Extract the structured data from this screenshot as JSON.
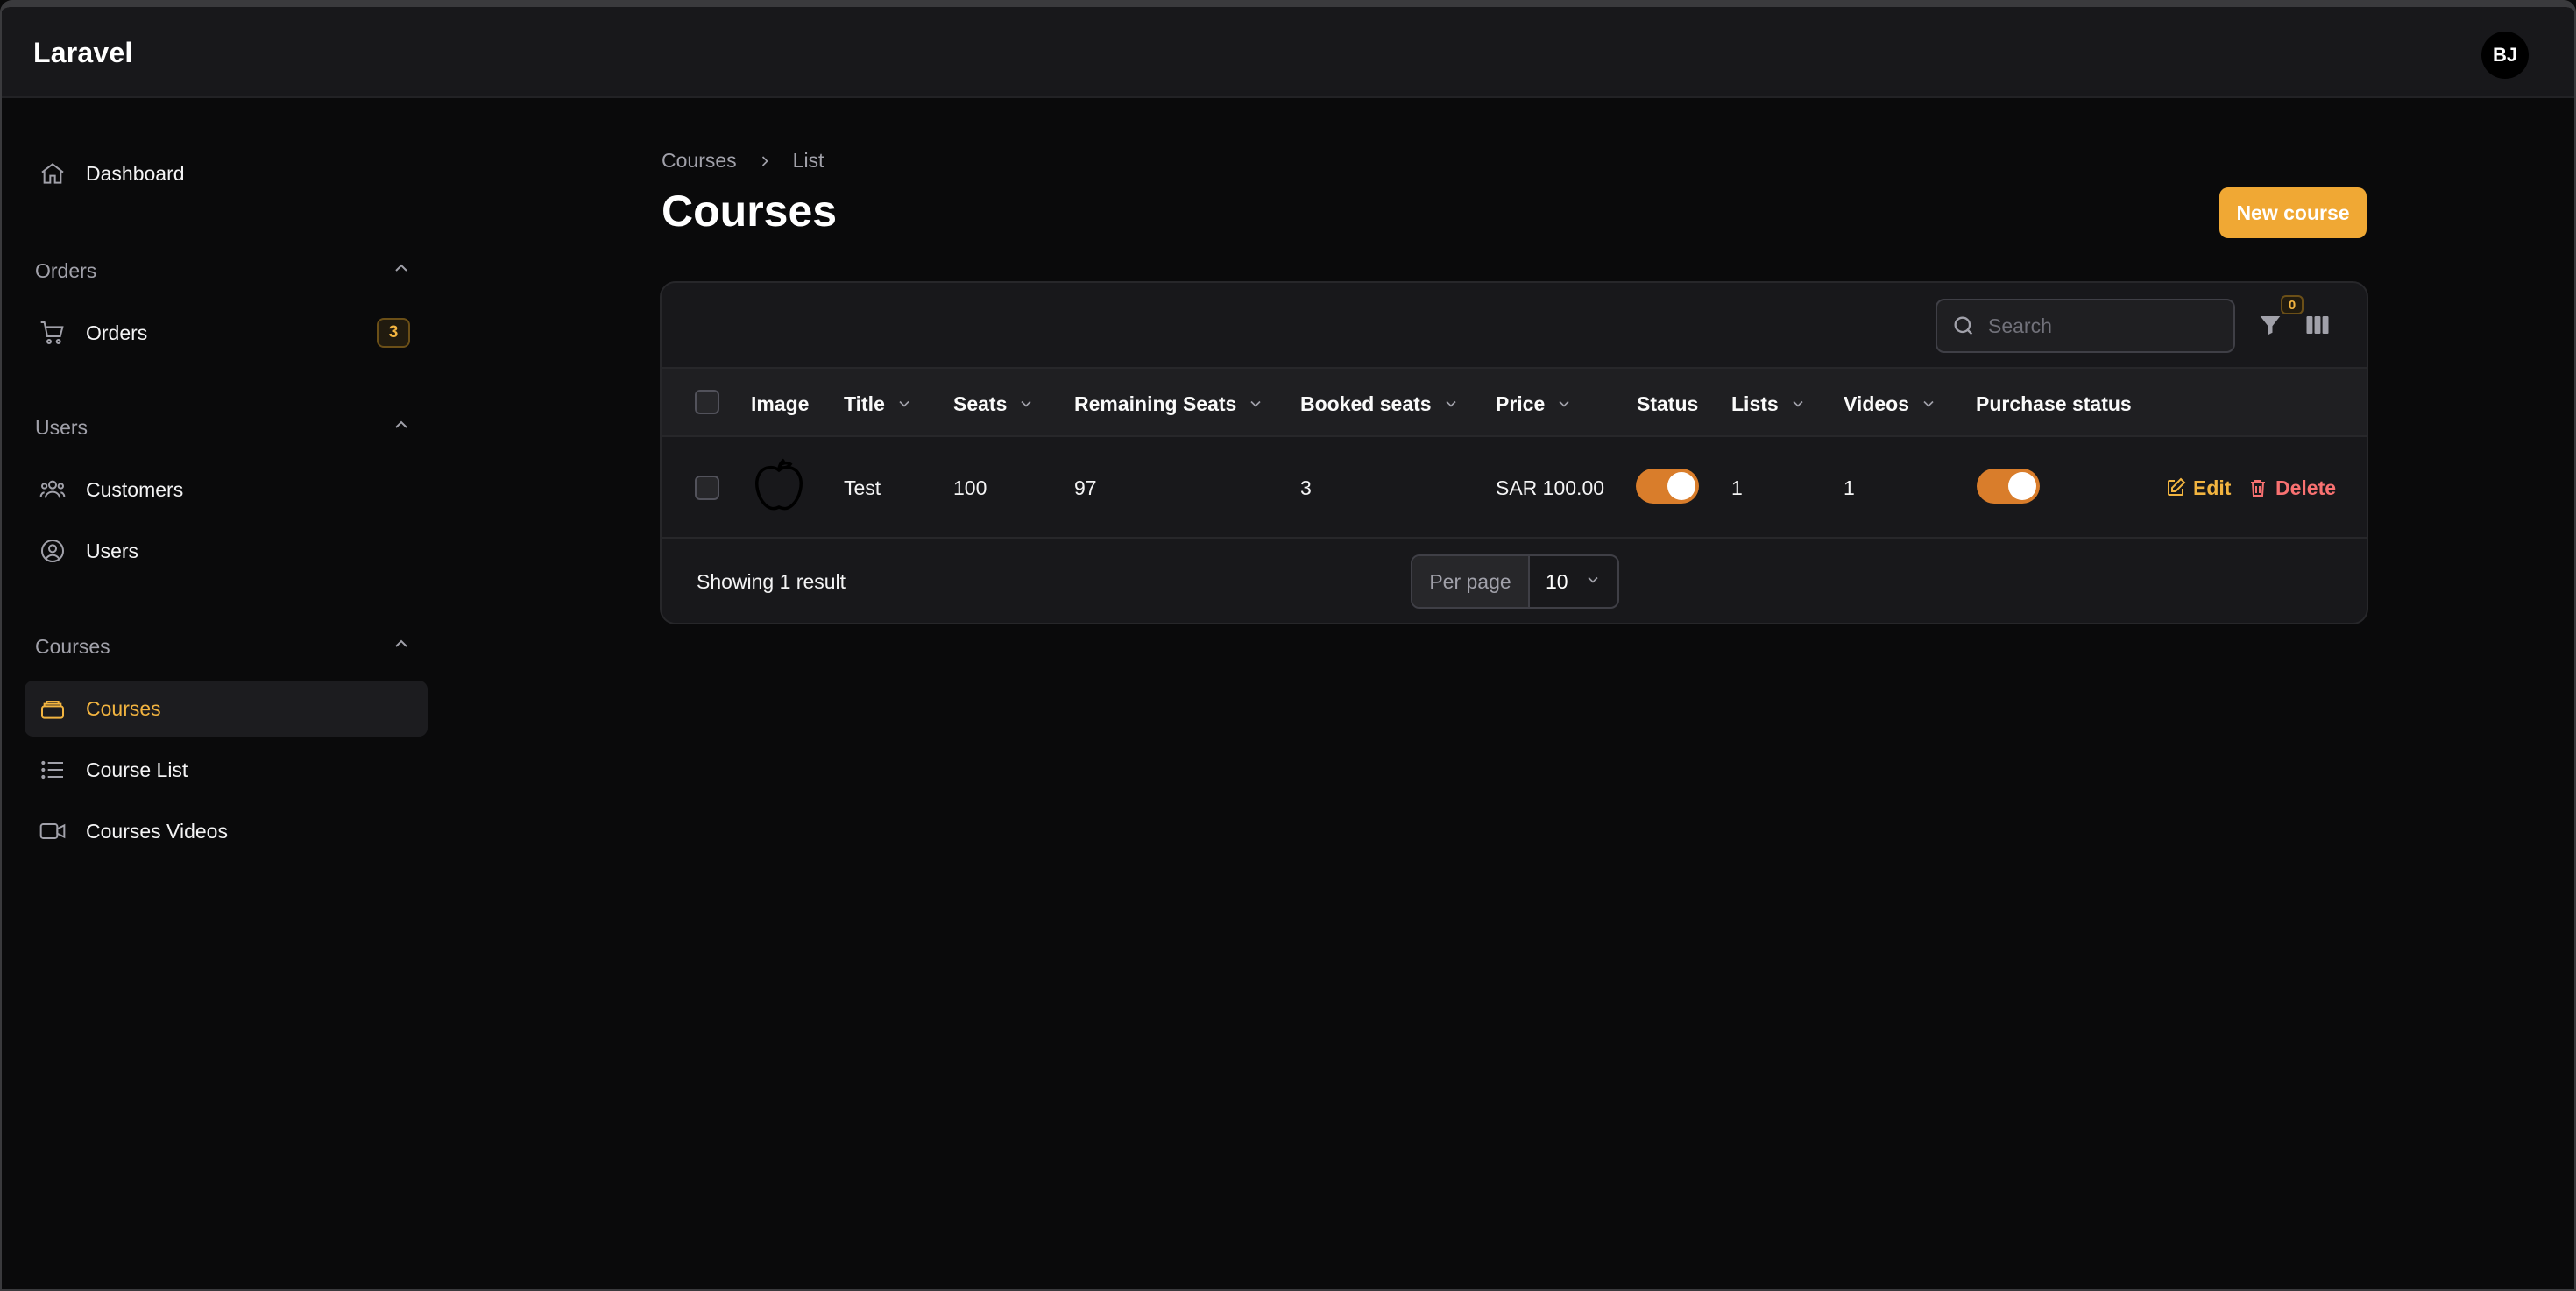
{
  "app": {
    "brand": "Laravel",
    "user_initials": "BJ"
  },
  "sidebar": {
    "dashboard": "Dashboard",
    "groups": {
      "orders": {
        "label": "Orders",
        "items": [
          {
            "label": "Orders",
            "badge": "3"
          }
        ]
      },
      "users": {
        "label": "Users",
        "items": [
          {
            "label": "Customers"
          },
          {
            "label": "Users"
          }
        ]
      },
      "courses": {
        "label": "Courses",
        "items": [
          {
            "label": "Courses"
          },
          {
            "label": "Course List"
          },
          {
            "label": "Courses Videos"
          }
        ]
      }
    },
    "active_item": "Courses"
  },
  "breadcrumb": [
    "Courses",
    "List"
  ],
  "page": {
    "title": "Courses",
    "new_button": "New course"
  },
  "table": {
    "search_placeholder": "Search",
    "filter_count": "0",
    "columns": [
      "Image",
      "Title",
      "Seats",
      "Remaining Seats",
      "Booked seats",
      "Price",
      "Status",
      "Lists",
      "Videos",
      "Purchase status"
    ],
    "rows": [
      {
        "image": "apple-icon",
        "title": "Test",
        "seats": "100",
        "remaining_seats": "97",
        "booked_seats": "3",
        "price": "SAR 100.00",
        "status": true,
        "lists": "1",
        "videos": "1",
        "purchase_status": true,
        "actions": {
          "edit": "Edit",
          "delete": "Delete"
        }
      }
    ],
    "footer": {
      "result_text": "Showing 1 result",
      "per_page_label": "Per page",
      "per_page_value": "10"
    }
  },
  "colors": {
    "accent": "#f0a834",
    "toggle_on": "#d97d2b",
    "danger": "#f87171",
    "background": "#0a0a0b"
  }
}
